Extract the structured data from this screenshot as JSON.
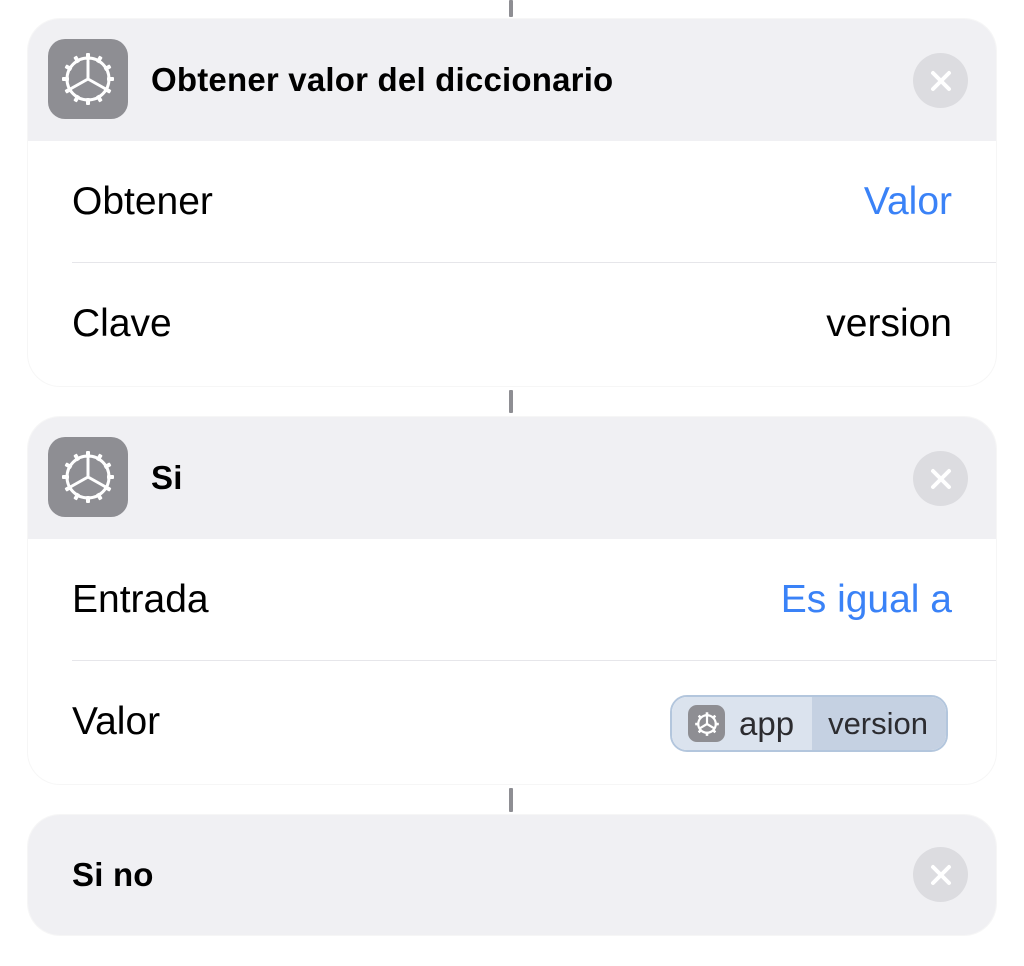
{
  "actions": [
    {
      "title": "Obtener valor del diccionario",
      "icon": "gear-icon",
      "rows": [
        {
          "label": "Obtener",
          "value": "Valor"
        },
        {
          "label": "Clave",
          "value": "version"
        }
      ]
    },
    {
      "title": "Si",
      "icon": "gear-icon",
      "rows": [
        {
          "label": "Entrada",
          "value": "Es igual a"
        },
        {
          "label": "Valor",
          "variable": {
            "source": "app",
            "key": "version",
            "icon": "gear-icon"
          }
        }
      ]
    },
    {
      "title": "Si no"
    }
  ],
  "colors": {
    "accent_blue": "#3a82f7",
    "header_bg": "#f0f0f3",
    "icon_gray": "#8e8e93",
    "close_bg": "#dcdce0"
  }
}
